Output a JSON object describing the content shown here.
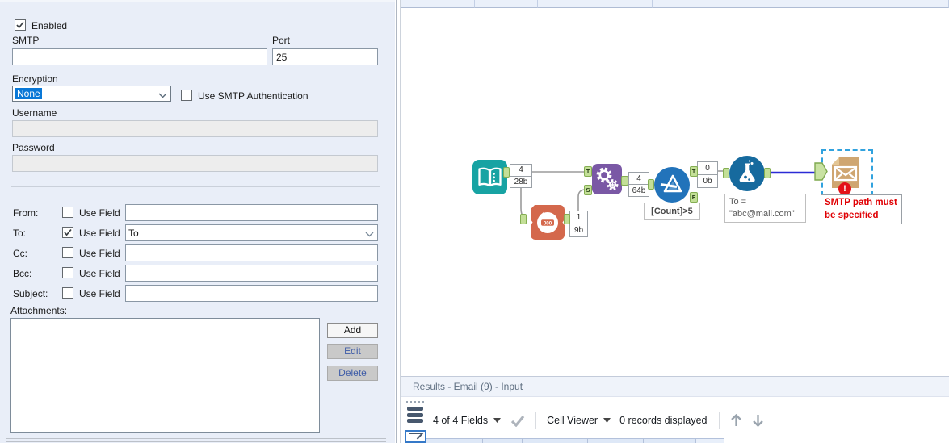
{
  "panel": {
    "enabled_label": "Enabled",
    "smtp_label": "SMTP",
    "smtp_value": "",
    "port_label": "Port",
    "port_value": "25",
    "encryption_label": "Encryption",
    "encryption_value": "None",
    "use_auth_label": "Use SMTP Authentication",
    "username_label": "Username",
    "username_value": "",
    "password_label": "Password",
    "password_value": "",
    "use_field_label": "Use Field",
    "rows": [
      {
        "label": "From:",
        "use_field_checked": false,
        "value": ""
      },
      {
        "label": "To:",
        "use_field_checked": true,
        "value": "To"
      },
      {
        "label": "Cc:",
        "use_field_checked": false,
        "value": ""
      },
      {
        "label": "Bcc:",
        "use_field_checked": false,
        "value": ""
      },
      {
        "label": "Subject:",
        "use_field_checked": false,
        "value": ""
      }
    ],
    "attachments_label": "Attachments:",
    "add_label": "Add",
    "edit_label": "Edit",
    "delete_label": "Delete"
  },
  "canvas": {
    "tools": [
      "text-input",
      "count-records",
      "append-fields",
      "filter",
      "formula",
      "email"
    ],
    "odometer": "000",
    "counts": [
      {
        "records": "4",
        "size": "28b"
      },
      {
        "records": "1",
        "size": "9b"
      },
      {
        "records": "4",
        "size": "64b"
      },
      {
        "records": "0",
        "size": "0b"
      }
    ],
    "anchors": {
      "t": "T",
      "s": "S",
      "f": "F"
    },
    "annotations": {
      "filter": "[Count]>5",
      "formula_line1": "To =",
      "formula_line2": "\"abc@mail.com\""
    },
    "error": {
      "badge": "!",
      "line1": "SMTP path must",
      "line2": "be specified"
    }
  },
  "results": {
    "title": "Results - Email (9) - Input",
    "fields_label": "4 of 4 Fields",
    "cell_viewer_label": "Cell Viewer",
    "records_label": "0 records displayed"
  },
  "colors": {
    "panel_bg": "#E9EEF8",
    "selection_highlight": "#0A78D7",
    "text_input_teal": "#17A3A3",
    "count_records_orange": "#D4684C",
    "append_fields_purple": "#7A58A5",
    "filter_blue": "#2273BA",
    "formula_blue": "#166A9E",
    "email_tan": "#CFA671",
    "anchor_green": "#C3DF97",
    "error_red": "#E41117",
    "selection_dash_blue": "#31A2DE",
    "wire_gray": "#9B9B9B",
    "wire_selected_blue": "#2B2BD5"
  }
}
